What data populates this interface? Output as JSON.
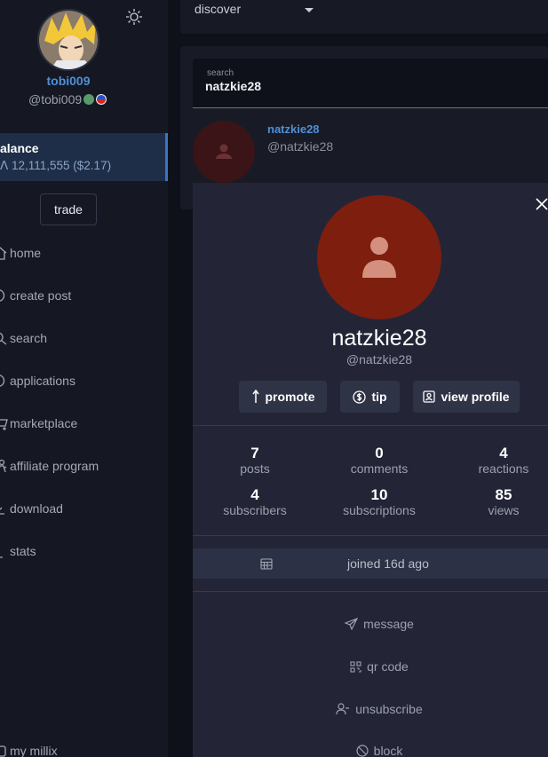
{
  "user": {
    "username": "tobi009",
    "handle": "@tobi009"
  },
  "balance": {
    "title": "alance",
    "value": "ꓥ 12,111,555 ($2.17)"
  },
  "trade_label": "trade",
  "nav": [
    {
      "label": "home",
      "icon": "home-icon"
    },
    {
      "label": "create post",
      "icon": "plus-circle-icon"
    },
    {
      "label": "search",
      "icon": "search-icon"
    },
    {
      "label": "applications",
      "icon": "grid-icon"
    },
    {
      "label": "marketplace",
      "icon": "cart-icon"
    },
    {
      "label": "affiliate program",
      "icon": "people-icon"
    },
    {
      "label": "download",
      "icon": "download-icon"
    },
    {
      "label": "stats",
      "icon": "chart-icon"
    },
    {
      "label": "my millix",
      "icon": "wallet-icon"
    }
  ],
  "topbar": {
    "select_value": "discover"
  },
  "search": {
    "label": "search",
    "value": "natzkie28"
  },
  "result": {
    "name": "natzkie28",
    "handle": "@natzkie28"
  },
  "profile": {
    "name": "natzkie28",
    "handle": "@natzkie28",
    "actions": {
      "promote": "promote",
      "tip": "tip",
      "view_profile": "view profile"
    },
    "stats": {
      "posts": {
        "value": "7",
        "label": "posts"
      },
      "comments": {
        "value": "0",
        "label": "comments"
      },
      "reactions": {
        "value": "4",
        "label": "reactions"
      },
      "subscribers": {
        "value": "4",
        "label": "subscribers"
      },
      "subscriptions": {
        "value": "10",
        "label": "subscriptions"
      },
      "views": {
        "value": "85",
        "label": "views"
      }
    },
    "joined": "joined 16d ago",
    "links": {
      "message": "message",
      "qr_code": "qr code",
      "unsubscribe": "unsubscribe",
      "block": "block"
    }
  },
  "colors": {
    "accent": "#4f8fd6",
    "avatar_red": "#7e1e0e",
    "sidebar_bg": "#151823",
    "modal_bg": "#232537"
  }
}
